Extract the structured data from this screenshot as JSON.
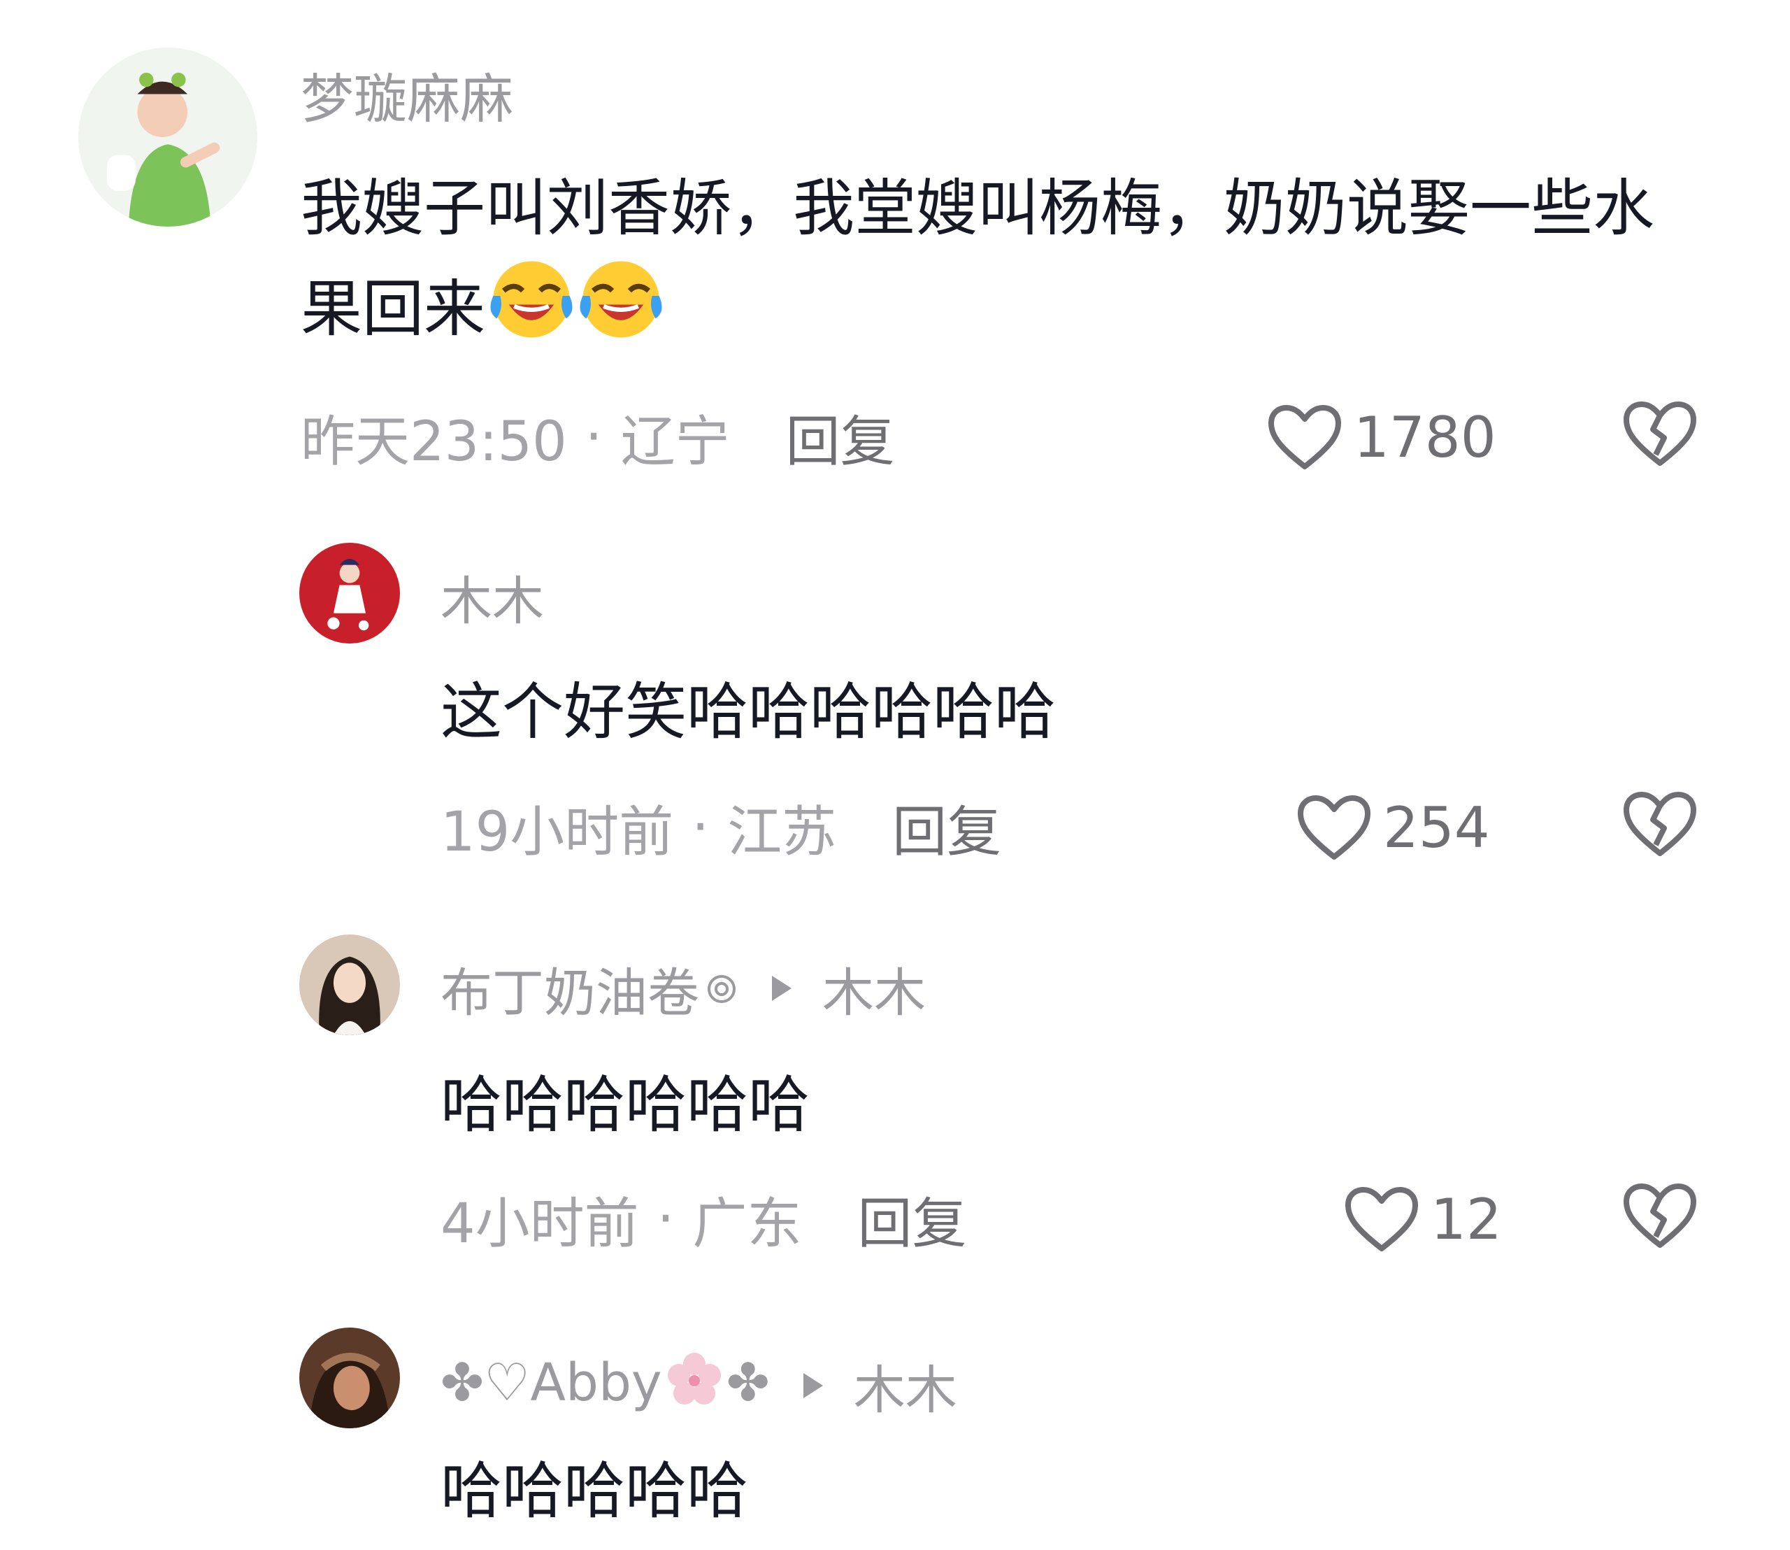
{
  "comments": [
    {
      "author": "梦璇麻麻",
      "text": "我嫂子叫刘香娇，我堂嫂叫杨梅，奶奶说娶一些水果回来",
      "emoji": "crying-laughing-emoji",
      "emoji_count": 2,
      "time": "昨天23:50",
      "location": "辽宁",
      "reply_label": "回复",
      "likes": "1780"
    },
    {
      "author": "木木",
      "text": "这个好笑哈哈哈哈哈哈",
      "time": "19小时前",
      "location": "江苏",
      "reply_label": "回复",
      "likes": "254"
    },
    {
      "author": "布丁奶油卷",
      "reply_to": "木木",
      "text": "哈哈哈哈哈哈",
      "time": "4小时前",
      "location": "广东",
      "reply_label": "回复",
      "likes": "12"
    },
    {
      "author_prefix": "✤♡Abby",
      "author_suffix": "✤",
      "reply_to": "木木",
      "text": "哈哈哈哈哈"
    }
  ],
  "separator": "·",
  "icons": {
    "like": "heart-outline-icon",
    "dislike": "broken-heart-icon",
    "reply_arrow": "triangle-right-icon"
  }
}
